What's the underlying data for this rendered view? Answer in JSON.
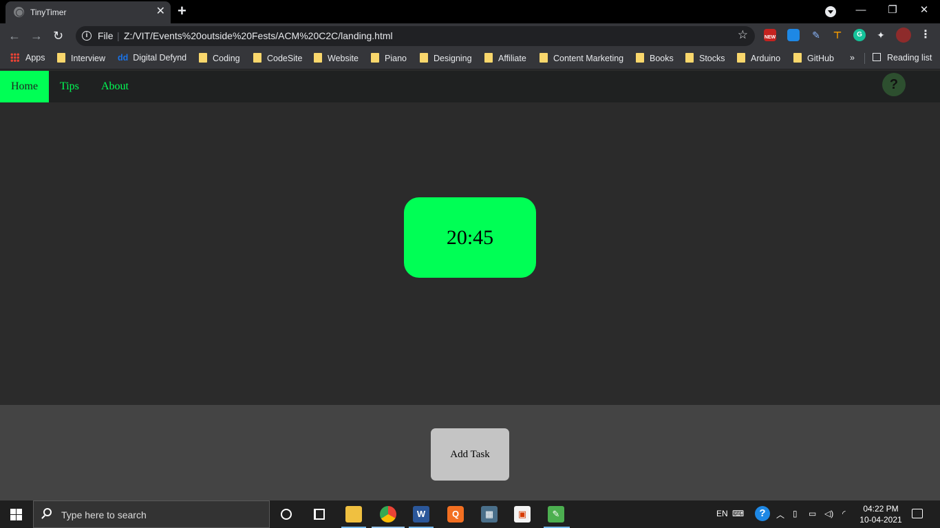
{
  "browser": {
    "tab_title": "TinyTimer",
    "tab_close": "✕",
    "new_tab": "+",
    "minimize": "—",
    "restore": "❐",
    "close": "✕",
    "url_scheme": "File",
    "url": "Z:/VIT/Events%20outside%20Fests/ACM%20C2C/landing.html",
    "bookmarks": [
      {
        "label": "Apps",
        "icon": "apps-grid-icon"
      },
      {
        "label": "Interview",
        "icon": "folder-icon"
      },
      {
        "label": "Digital Defynd",
        "icon": "dd-logo-icon"
      },
      {
        "label": "Coding",
        "icon": "folder-icon"
      },
      {
        "label": "CodeSite",
        "icon": "folder-icon"
      },
      {
        "label": "Website",
        "icon": "folder-icon"
      },
      {
        "label": "Piano",
        "icon": "folder-icon"
      },
      {
        "label": "Designing",
        "icon": "folder-icon"
      },
      {
        "label": "Affiliate",
        "icon": "folder-icon"
      },
      {
        "label": "Content Marketing",
        "icon": "folder-icon"
      },
      {
        "label": "Books",
        "icon": "folder-icon"
      },
      {
        "label": "Stocks",
        "icon": "folder-icon"
      },
      {
        "label": "Arduino",
        "icon": "folder-icon"
      },
      {
        "label": "GitHub",
        "icon": "folder-icon"
      }
    ],
    "more_bookmarks": "»",
    "reading_list": "Reading list",
    "extension_badge": "NEW"
  },
  "app": {
    "nav": [
      {
        "label": "Home",
        "active": true
      },
      {
        "label": "Tips",
        "active": false
      },
      {
        "label": "About",
        "active": false
      }
    ],
    "help_label": "?",
    "timer": "20:45",
    "add_task_label": "Add Task",
    "accent_color": "#00ff55"
  },
  "taskbar": {
    "search_placeholder": "Type here to search",
    "language": "EN",
    "time": "04:22 PM",
    "date": "10-04-2021"
  }
}
